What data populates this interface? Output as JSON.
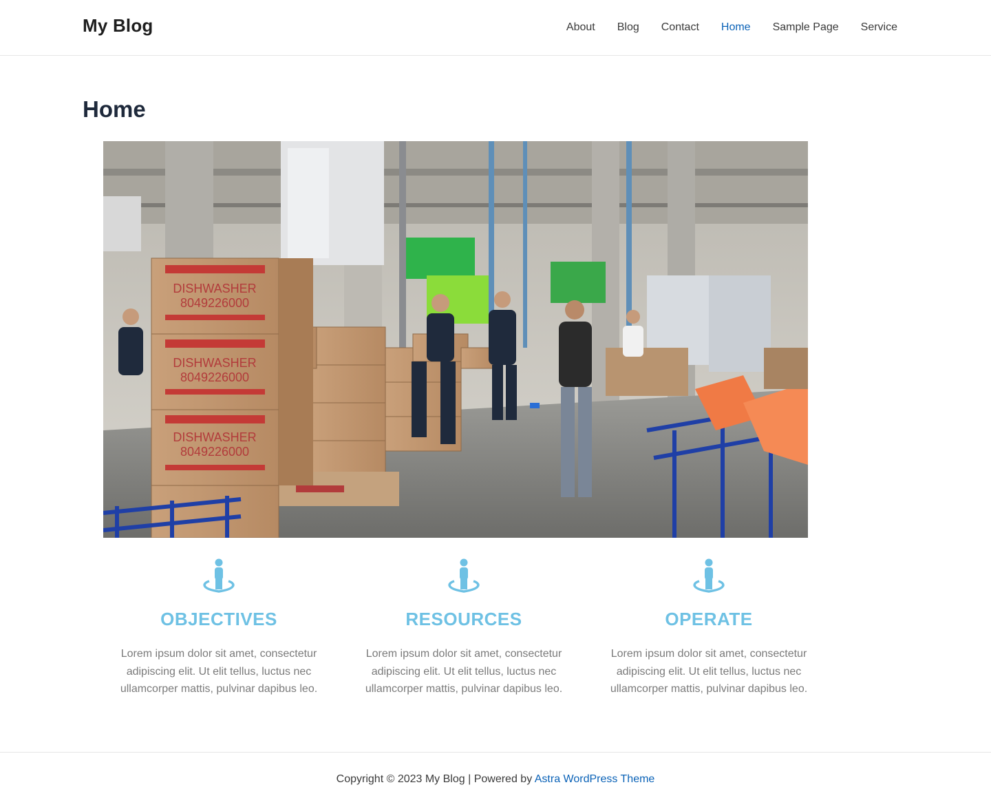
{
  "header": {
    "site_title": "My Blog",
    "nav": [
      {
        "label": "About",
        "active": false
      },
      {
        "label": "Blog",
        "active": false
      },
      {
        "label": "Contact",
        "active": false
      },
      {
        "label": "Home",
        "active": true
      },
      {
        "label": "Sample Page",
        "active": false
      },
      {
        "label": "Service",
        "active": false
      }
    ]
  },
  "page": {
    "title": "Home"
  },
  "hero": {
    "box_labels": {
      "line1": "DISHWASHER",
      "line2": "8049226000"
    }
  },
  "features": [
    {
      "icon": "person-on-platform-icon",
      "title": "OBJECTIVES",
      "text": "Lorem ipsum dolor sit amet, consectetur adipiscing elit. Ut elit tellus, luctus nec ullamcorper mattis, pulvinar dapibus leo."
    },
    {
      "icon": "person-on-platform-icon",
      "title": "RESOURCES",
      "text": "Lorem ipsum dolor sit amet, consectetur adipiscing elit. Ut elit tellus, luctus nec ullamcorper mattis, pulvinar dapibus leo."
    },
    {
      "icon": "person-on-platform-icon",
      "title": "OPERATE",
      "text": "Lorem ipsum dolor sit amet, consectetur adipiscing elit. Ut elit tellus, luctus nec ullamcorper mattis, pulvinar dapibus leo."
    }
  ],
  "footer": {
    "copyright": "Copyright © 2023 My Blog | Powered by",
    "link": "Astra WordPress Theme"
  },
  "colors": {
    "accent": "#6ec1e4",
    "link": "#0a62b7",
    "heading": "#1e293b",
    "body_text": "#7a7a7a"
  }
}
